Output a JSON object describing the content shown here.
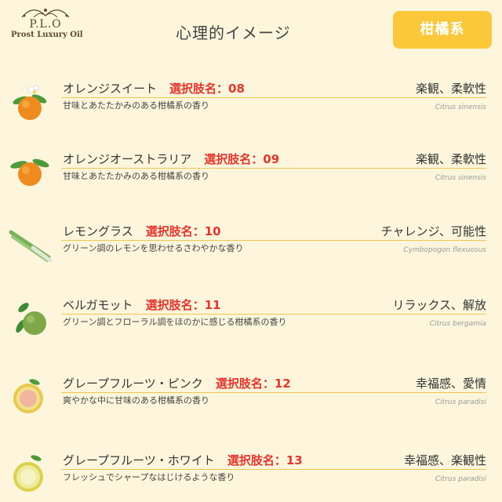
{
  "logo": {
    "mark": "P.L.O",
    "name": "Prost Luxury Oil"
  },
  "header": {
    "title": "心理的イメージ"
  },
  "category_button": {
    "label": "柑橘系"
  },
  "items": [
    {
      "name": "オレンジスイート",
      "selection": "選択肢名：08",
      "description": "甘味とあたたかみのある柑橘系の香り",
      "effect": "楽観、柔軟性",
      "latin": "Citrus sinensis",
      "icon": "orange-flower-icon"
    },
    {
      "name": "オレンジオーストラリア",
      "selection": "選択肢名：09",
      "description": "甘味とあたたかみのある柑橘系の香り",
      "effect": "楽観、柔軟性",
      "latin": "Citrus sinensis",
      "icon": "orange-icon"
    },
    {
      "name": "レモングラス",
      "selection": "選択肢名：10",
      "description": "グリーン調のレモンを思わせるさわやかな香り",
      "effect": "チャレンジ、可能性",
      "latin": "Cymbopogon flexuosus",
      "icon": "lemongrass-icon"
    },
    {
      "name": "ベルガモット",
      "selection": "選択肢名：11",
      "description": "グリーン調とフローラル調をほのかに感じる柑橘系の香り",
      "effect": "リラックス、解放",
      "latin": "Citrus bergamia",
      "icon": "bergamot-icon"
    },
    {
      "name": "グレープフルーツ・ピンク",
      "selection": "選択肢名：12",
      "description": "爽やかな中に甘味のある柑橘系の香り",
      "effect": "幸福感、愛情",
      "latin": "Citrus paradisi",
      "icon": "pink-grapefruit-icon"
    },
    {
      "name": "グレープフルーツ・ホワイト",
      "selection": "選択肢名：13",
      "description": "フレッシュでシャープなはじけるような香り",
      "effect": "幸福感、楽観性",
      "latin": "Citrus paradisi",
      "icon": "white-grapefruit-icon"
    }
  ]
}
